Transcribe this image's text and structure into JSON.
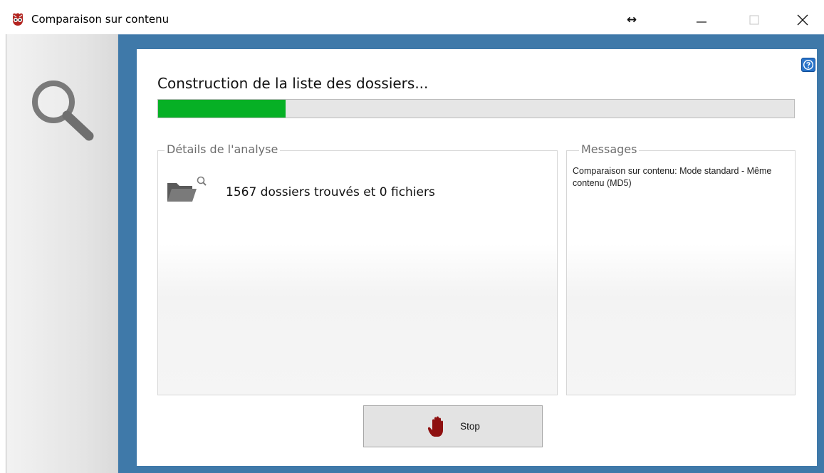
{
  "window": {
    "title": "Comparaison sur contenu",
    "app_icon": "app-icon-red",
    "controls": {
      "resize_glyph": "↔",
      "minimize_icon": "minimize-icon",
      "maximize_icon": "maximize-icon",
      "close_icon": "close-icon"
    }
  },
  "sidebar": {
    "icon": "search-icon"
  },
  "panel": {
    "help_icon": "help-icon",
    "heading": "Construction de la liste des dossiers...",
    "progress": {
      "fraction": 0.2,
      "color": "#06b025"
    }
  },
  "details": {
    "legend": "Détails de l'analyse",
    "icon": "folder-search-icon",
    "text": "1567 dossiers trouvés et 0 fichiers"
  },
  "messages": {
    "legend": "Messages",
    "text": "Comparaison sur contenu: Mode standard - Même contenu (MD5)"
  },
  "stop_button": {
    "label": "Stop",
    "icon": "stop-hand-icon"
  },
  "colors": {
    "frame_blue": "#3f79a9",
    "progress_green": "#06b025",
    "help_blue": "#2a74c9",
    "stop_hand_red": "#8e1010"
  }
}
